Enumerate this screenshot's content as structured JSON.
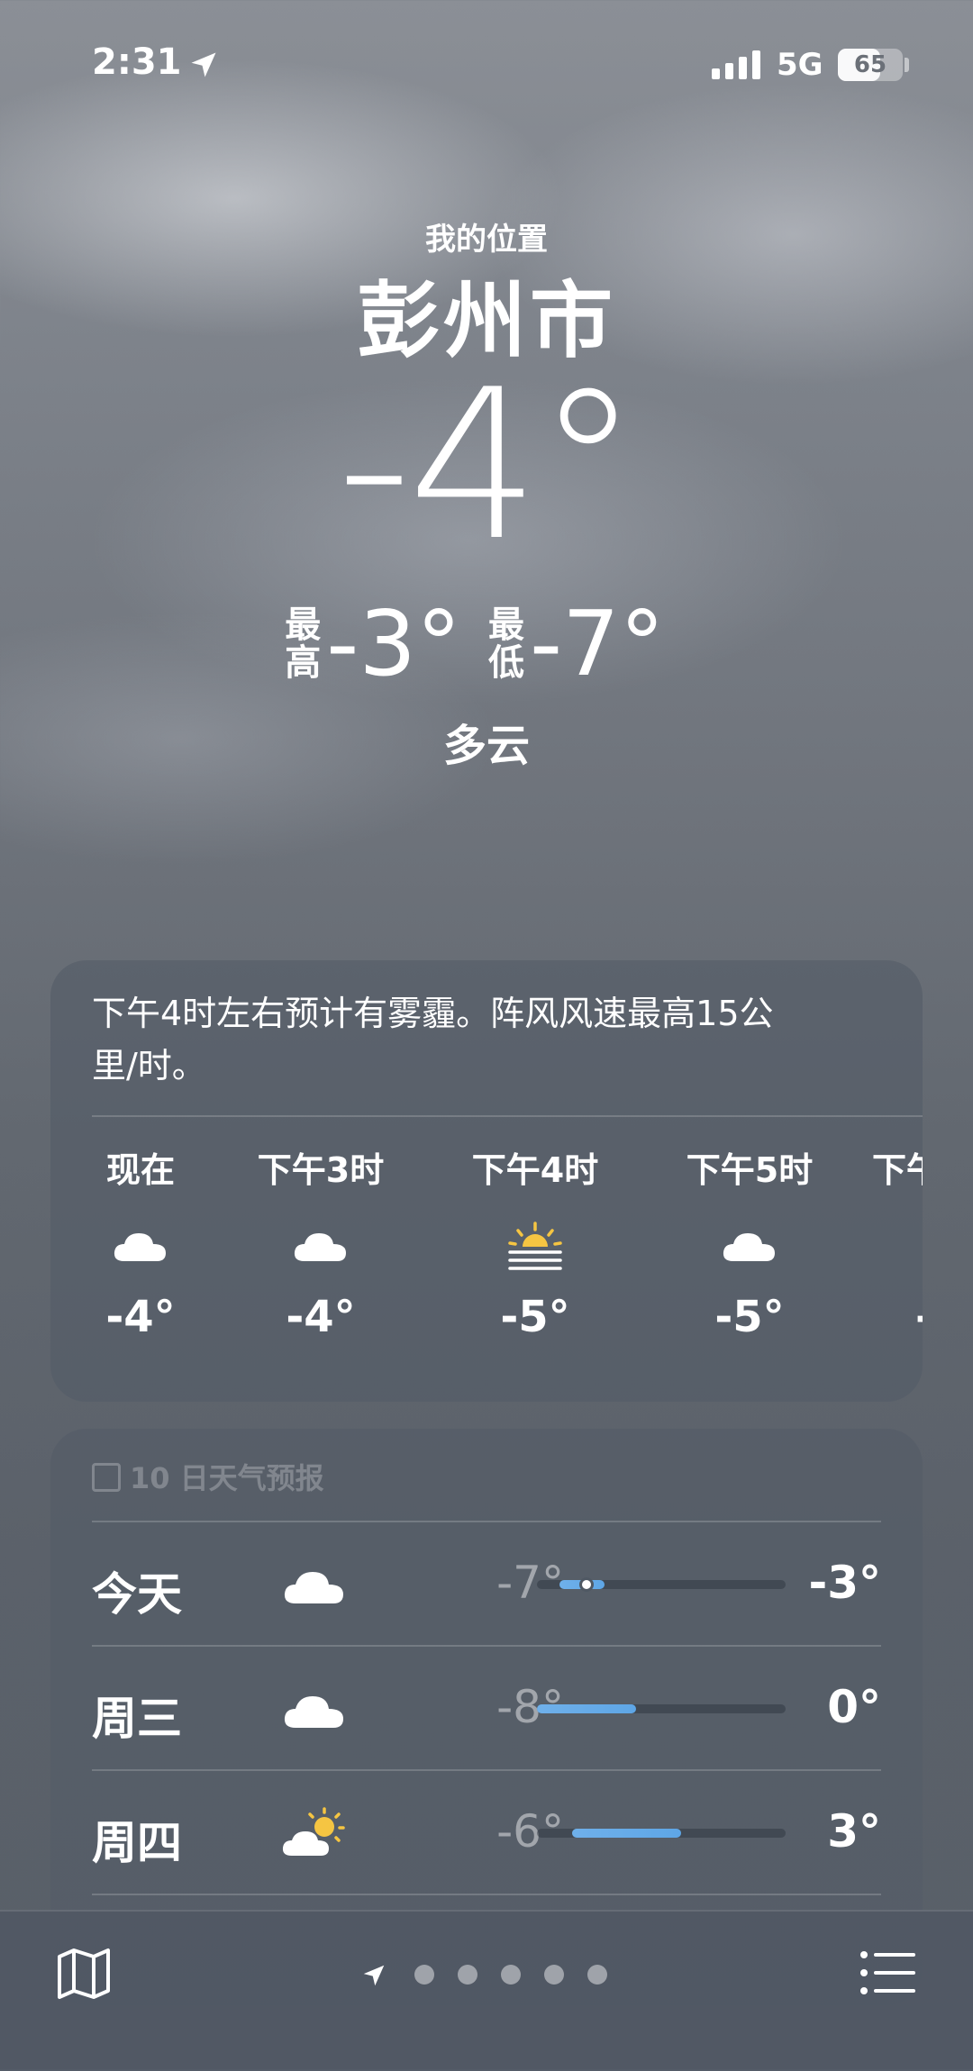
{
  "status_bar": {
    "time": "2:31",
    "network": "5G",
    "battery": "65",
    "battery_level": 0.65
  },
  "location": {
    "label": "我的位置",
    "city": "彭州市"
  },
  "current": {
    "temperature": "-4°",
    "high_label": "最高",
    "high": "-3°",
    "low_label": "最低",
    "low": "-7°",
    "condition": "多云"
  },
  "hourly_card": {
    "summary": "下午4时左右预计有雾霾。阵风风速最高15公里/时。",
    "hours": [
      {
        "label": "现在",
        "icon": "cloud-icon",
        "temp": "-4°"
      },
      {
        "label": "下午3时",
        "icon": "cloud-icon",
        "temp": "-4°"
      },
      {
        "label": "下午4时",
        "icon": "sunrise-haze-icon",
        "temp": "-5°"
      },
      {
        "label": "下午5时",
        "icon": "cloud-icon",
        "temp": "-5°"
      },
      {
        "label": "下午",
        "icon": "cloud-icon",
        "temp": "-"
      }
    ]
  },
  "daily_card": {
    "header": "10 日天气预报",
    "days": [
      {
        "name": "今天",
        "icon": "cloud-icon",
        "low": "-7°",
        "high": "-3°",
        "range_start": 0.09,
        "range_end": 0.27,
        "current_pos": 0.2
      },
      {
        "name": "周三",
        "icon": "cloud-icon",
        "low": "-8°",
        "high": "0°",
        "range_start": 0.0,
        "range_end": 0.4
      },
      {
        "name": "周四",
        "icon": "partly-sunny-icon",
        "low": "-6°",
        "high": "3°",
        "range_start": 0.14,
        "range_end": 0.58
      }
    ]
  },
  "bottom_bar": {
    "map_icon": "map-icon",
    "list_icon": "list-icon",
    "page_count": 5
  },
  "colors": {
    "range_bar": "#5ea6e6",
    "sun": "#f5c542"
  }
}
